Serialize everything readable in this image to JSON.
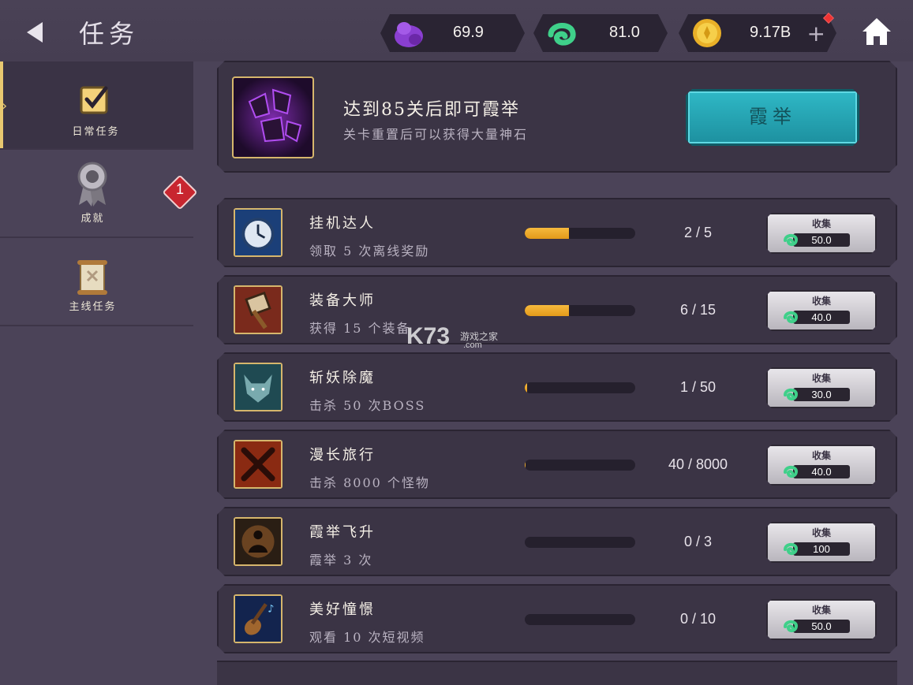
{
  "header": {
    "title": "任务",
    "resources": [
      {
        "icon": "purple-stone-icon",
        "value": "69.9"
      },
      {
        "icon": "jade-icon",
        "value": "81.0"
      },
      {
        "icon": "gold-coin-icon",
        "value": "9.17B"
      }
    ],
    "plus_label": "+"
  },
  "sidebar": {
    "items": [
      {
        "label": "日常任务",
        "icon": "checkbox-icon"
      },
      {
        "label": "成就",
        "icon": "medal-icon"
      },
      {
        "label": "主线任务",
        "icon": "scroll-icon"
      }
    ],
    "badge": "1"
  },
  "banner": {
    "title": "达到85关后即可霞举",
    "subtitle": "关卡重置后可以获得大量神石",
    "button_label": "霞举"
  },
  "quests": [
    {
      "title": "挂机达人",
      "desc": "领取 5 次离线奖励",
      "progress_text": "2 / 5",
      "progress": 0.4,
      "collect_label": "收集",
      "reward": "50.0",
      "icon": "clock-icon"
    },
    {
      "title": "装备大师",
      "desc": "获得 15 个装备",
      "progress_text": "6 / 15",
      "progress": 0.4,
      "collect_label": "收集",
      "reward": "40.0",
      "icon": "hammer-icon"
    },
    {
      "title": "斩妖除魔",
      "desc": "击杀 50 次BOSS",
      "progress_text": "1 / 50",
      "progress": 0.02,
      "collect_label": "收集",
      "reward": "30.0",
      "icon": "wolf-icon"
    },
    {
      "title": "漫长旅行",
      "desc": "击杀 8000 个怪物",
      "progress_text": "40 / 8000",
      "progress": 0.005,
      "collect_label": "收集",
      "reward": "40.0",
      "icon": "crossed-swords-icon"
    },
    {
      "title": "霞举飞升",
      "desc": "霞举 3 次",
      "progress_text": "0 / 3",
      "progress": 0,
      "collect_label": "收集",
      "reward": "100",
      "icon": "meditation-icon"
    },
    {
      "title": "美好憧憬",
      "desc": "观看 10 次短视频",
      "progress_text": "0 / 10",
      "progress": 0,
      "collect_label": "收集",
      "reward": "50.0",
      "icon": "guitar-icon"
    }
  ],
  "watermark": {
    "brand": "K73",
    "sub": "游戏之家",
    "domain": ".com"
  },
  "colors": {
    "accent_teal": "#2fb8c6",
    "progress_orange": "#f6b93d",
    "badge_red": "#c8262f",
    "frame_gold": "#d6b66c"
  }
}
